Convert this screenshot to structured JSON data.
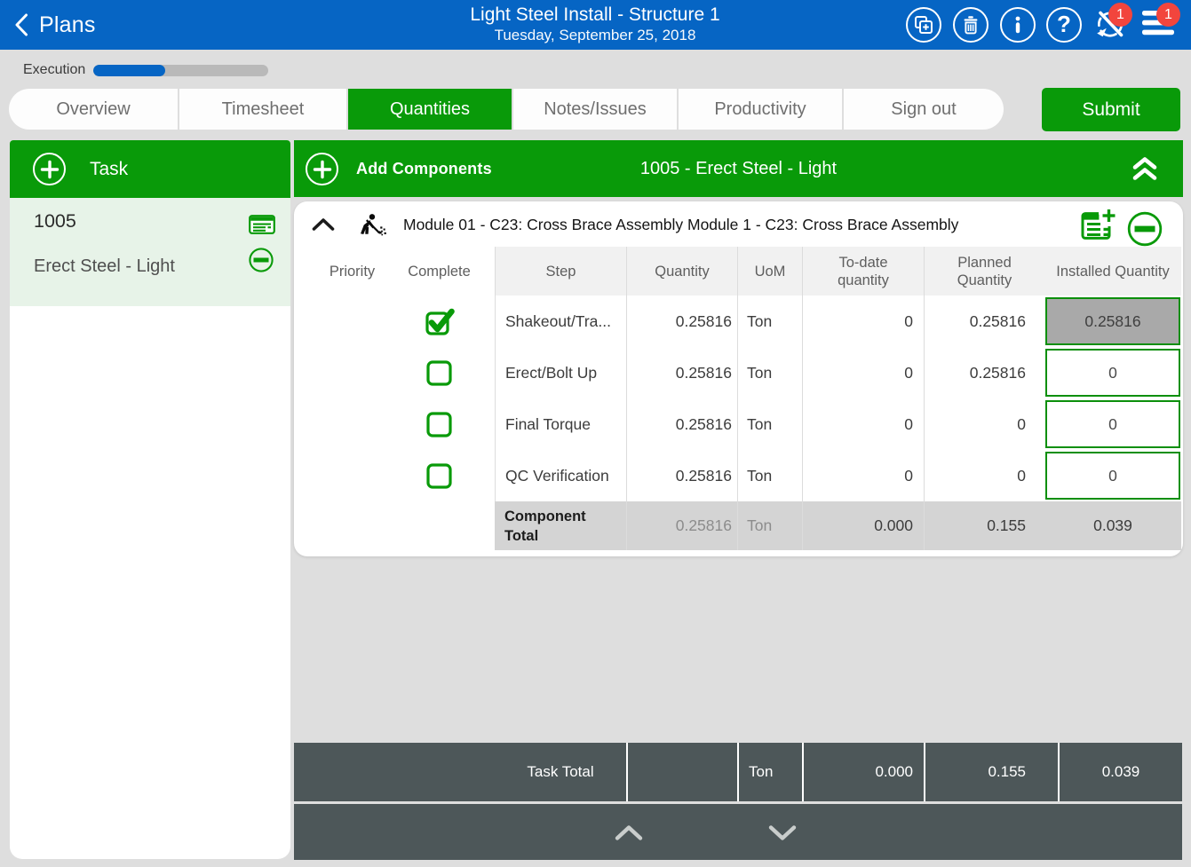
{
  "colors": {
    "topbar_blue": "#0665C4",
    "accent_green": "#099A09",
    "badge_red": "#F2453D",
    "page_background": "#DEDEDE",
    "selected_task_background": "#E7F3E8",
    "totals_bar_slate": "#4D5759",
    "component_total_gray": "#D4D4D4",
    "disabled_input_gray": "#A9A9A9"
  },
  "topbar": {
    "back_label": "Plans",
    "title": "Light Steel Install - Structure 1",
    "date": "Tuesday, September 25, 2018",
    "icons": [
      "copy-icon",
      "trash-icon",
      "info-icon",
      "help-icon",
      "sync-off-icon",
      "menu-icon"
    ],
    "sync_badge": "1",
    "menu_badge": "1"
  },
  "execution": {
    "label": "Execution",
    "progress_percent": 41
  },
  "tabs": {
    "items": [
      "Overview",
      "Timesheet",
      "Quantities",
      "Notes/Issues",
      "Productivity",
      "Sign out"
    ],
    "active": "Quantities",
    "submit_label": "Submit"
  },
  "task_panel": {
    "header": "Task",
    "task_number": "1005",
    "task_name": "Erect Steel - Light"
  },
  "component_bar": {
    "add_label": "Add Components",
    "title": "1005 - Erect Steel - Light"
  },
  "component": {
    "title": "Module 01 - C23: Cross Brace Assembly Module 1 - C23: Cross Brace Assembly"
  },
  "table": {
    "columns": [
      "Priority",
      "Complete",
      "Step",
      "Quantity",
      "UoM",
      "To-date quantity",
      "Planned Quantity",
      "Installed Quantity"
    ],
    "rows": [
      {
        "complete": true,
        "step": "Shakeout/Tra...",
        "quantity": "0.25816",
        "uom": "Ton",
        "to_date": "0",
        "planned": "0.25816",
        "installed": "0.25816",
        "installed_disabled": true
      },
      {
        "complete": false,
        "step": "Erect/Bolt Up",
        "quantity": "0.25816",
        "uom": "Ton",
        "to_date": "0",
        "planned": "0.25816",
        "installed": "0",
        "installed_disabled": false
      },
      {
        "complete": false,
        "step": "Final Torque",
        "quantity": "0.25816",
        "uom": "Ton",
        "to_date": "0",
        "planned": "0",
        "installed": "0",
        "installed_disabled": false
      },
      {
        "complete": false,
        "step": "QC Verification",
        "quantity": "0.25816",
        "uom": "Ton",
        "to_date": "0",
        "planned": "0",
        "installed": "0",
        "installed_disabled": false
      }
    ],
    "component_total": {
      "label": "Component Total",
      "quantity": "0.25816",
      "uom": "Ton",
      "to_date": "0.000",
      "planned": "0.155",
      "installed": "0.039"
    }
  },
  "task_total": {
    "label": "Task Total",
    "quantity": "",
    "uom": "Ton",
    "to_date": "0.000",
    "planned": "0.155",
    "installed": "0.039"
  }
}
